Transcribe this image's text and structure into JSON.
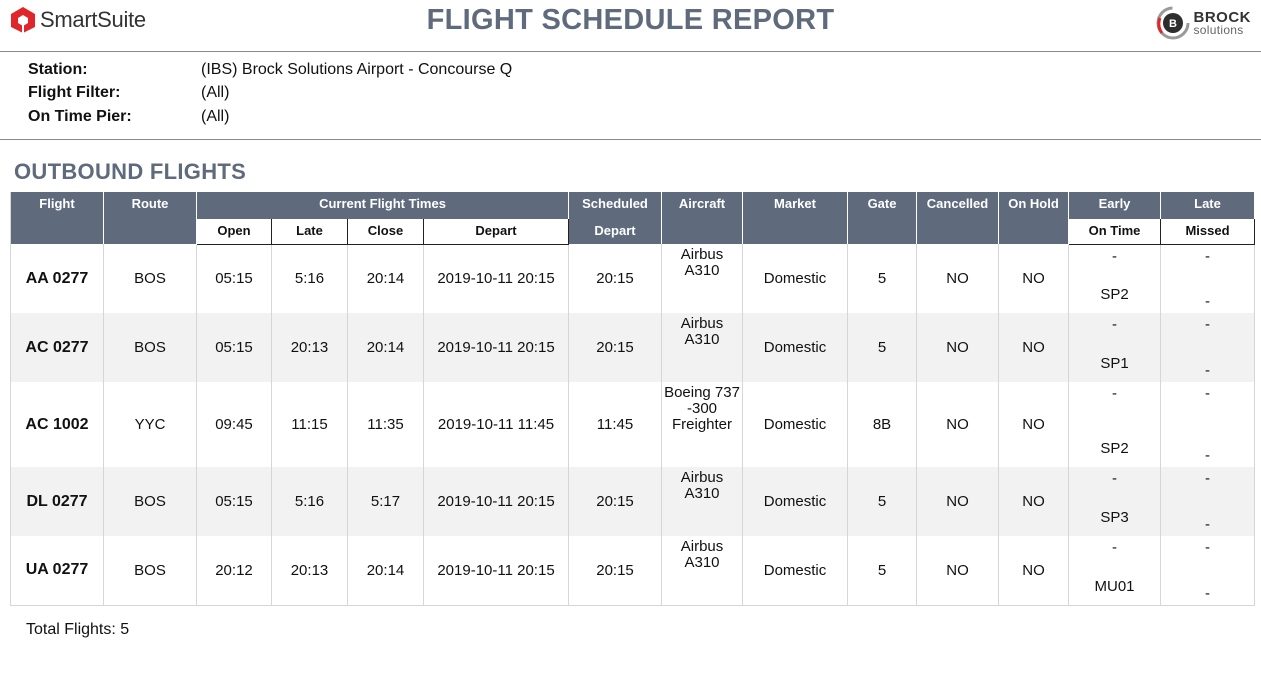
{
  "header": {
    "left_brand": "SmartSuite",
    "title": "FLIGHT SCHEDULE REPORT",
    "right_brand_line1": "BROCK",
    "right_brand_line2": "solutions",
    "right_brand_letter": "B"
  },
  "filters": [
    {
      "label": "Station:",
      "value": "(IBS) Brock Solutions Airport - Concourse Q"
    },
    {
      "label": "Flight Filter:",
      "value": "(All)"
    },
    {
      "label": "On Time Pier:",
      "value": "(All)"
    }
  ],
  "section_title": "OUTBOUND FLIGHTS",
  "columns": {
    "flight": "Flight",
    "route": "Route",
    "current_times": "Current Flight Times",
    "open": "Open",
    "late": "Late",
    "close": "Close",
    "depart": "Depart",
    "scheduled": "Scheduled",
    "scheduled_sub": "Depart",
    "aircraft": "Aircraft",
    "market": "Market",
    "gate": "Gate",
    "cancelled": "Cancelled",
    "on_hold": "On Hold",
    "early": "Early",
    "early_sub": "On Time",
    "late_pier": "Late",
    "late_pier_sub": "Missed"
  },
  "rows": [
    {
      "flight": "AA 0277",
      "route": "BOS",
      "open": "05:15",
      "late": "5:16",
      "close": "20:14",
      "depart": "2019-10-11 20:15",
      "scheduled": "20:15",
      "aircraft_l1": "Airbus",
      "aircraft_l2": "A310",
      "aircraft_l3": "",
      "market": "Domestic",
      "gate": "5",
      "cancelled": "NO",
      "on_hold": "NO",
      "early_top": "-",
      "early_bot": "SP2",
      "late_top": "-",
      "late_bot": "-"
    },
    {
      "flight": "AC 0277",
      "route": "BOS",
      "open": "05:15",
      "late": "20:13",
      "close": "20:14",
      "depart": "2019-10-11 20:15",
      "scheduled": "20:15",
      "aircraft_l1": "Airbus",
      "aircraft_l2": "A310",
      "aircraft_l3": "",
      "market": "Domestic",
      "gate": "5",
      "cancelled": "NO",
      "on_hold": "NO",
      "early_top": "-",
      "early_bot": "SP1",
      "late_top": "-",
      "late_bot": "-"
    },
    {
      "flight": "AC 1002",
      "route": "YYC",
      "open": "09:45",
      "late": "11:15",
      "close": "11:35",
      "depart": "2019-10-11 11:45",
      "scheduled": "11:45",
      "aircraft_l1": "Boeing 737",
      "aircraft_l2": "-300",
      "aircraft_l3": "Freighter",
      "market": "Domestic",
      "gate": "8B",
      "cancelled": "NO",
      "on_hold": "NO",
      "early_top": "-",
      "early_bot": "SP2",
      "late_top": "-",
      "late_bot": "-"
    },
    {
      "flight": "DL 0277",
      "route": "BOS",
      "open": "05:15",
      "late": "5:16",
      "close": "5:17",
      "depart": "2019-10-11 20:15",
      "scheduled": "20:15",
      "aircraft_l1": "Airbus",
      "aircraft_l2": "A310",
      "aircraft_l3": "",
      "market": "Domestic",
      "gate": "5",
      "cancelled": "NO",
      "on_hold": "NO",
      "early_top": "-",
      "early_bot": "SP3",
      "late_top": "-",
      "late_bot": "-"
    },
    {
      "flight": "UA 0277",
      "route": "BOS",
      "open": "20:12",
      "late": "20:13",
      "close": "20:14",
      "depart": "2019-10-11 20:15",
      "scheduled": "20:15",
      "aircraft_l1": "Airbus",
      "aircraft_l2": "A310",
      "aircraft_l3": "",
      "market": "Domestic",
      "gate": "5",
      "cancelled": "NO",
      "on_hold": "NO",
      "early_top": "-",
      "early_bot": "MU01",
      "late_top": "-",
      "late_bot": "-"
    }
  ],
  "total": "Total Flights: 5",
  "colors": {
    "header_bg": "#5f6b7d",
    "brand_red": "#e0262b",
    "alt_row": "#f2f2f2"
  }
}
